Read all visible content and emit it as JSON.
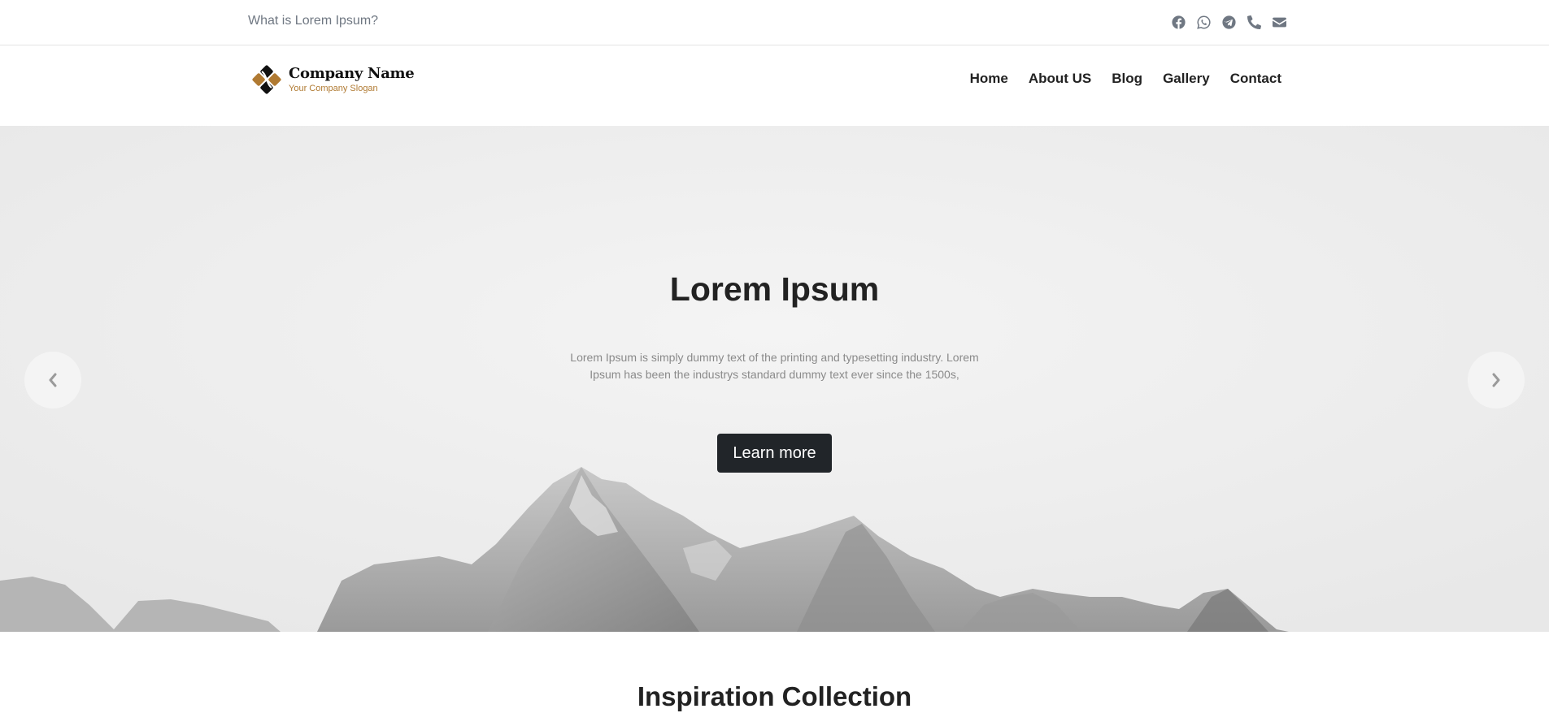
{
  "topbar": {
    "question": "What is Lorem Ipsum?",
    "social": [
      {
        "icon": "facebook-icon"
      },
      {
        "icon": "whatsapp-icon"
      },
      {
        "icon": "telegram-icon"
      },
      {
        "icon": "phone-icon"
      },
      {
        "icon": "envelope-icon"
      }
    ]
  },
  "header": {
    "company_name": "Company Name",
    "slogan": "Your Company Slogan",
    "nav": [
      {
        "label": "Home"
      },
      {
        "label": "About US"
      },
      {
        "label": "Blog"
      },
      {
        "label": "Gallery"
      },
      {
        "label": "Contact"
      }
    ]
  },
  "hero": {
    "title": "Lorem Ipsum",
    "text": "Lorem Ipsum is simply dummy text of the printing and typesetting industry. Lorem Ipsum has been the industrys standard dummy text ever since the 1500s,",
    "button_label": "Learn more",
    "prev_icon": "chevron-left-icon",
    "next_icon": "chevron-right-icon"
  },
  "section": {
    "title_light": "Inspiration",
    "title_bold": "Collection"
  },
  "colors": {
    "accent": "#b07a32",
    "dark": "#212529",
    "icon_gray": "#6f7782"
  }
}
